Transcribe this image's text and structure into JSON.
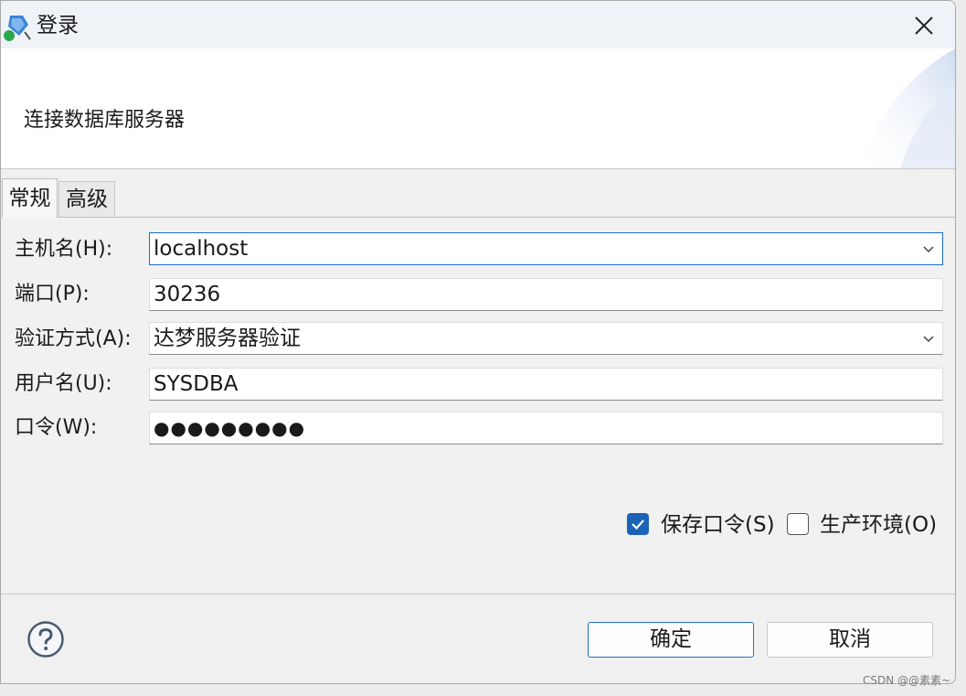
{
  "window": {
    "title": "登录",
    "app_icon": "database-connect-icon",
    "close_icon": "close-icon"
  },
  "header": {
    "description": "连接数据库服务器"
  },
  "tabs": [
    {
      "label": "常规",
      "selected": true
    },
    {
      "label": "高级",
      "selected": false
    }
  ],
  "form": {
    "host": {
      "label": "主机名(H):",
      "value": "localhost"
    },
    "port": {
      "label": "端口(P):",
      "value": "30236"
    },
    "auth": {
      "label": "验证方式(A):",
      "value": "达梦服务器验证"
    },
    "user": {
      "label": "用户名(U):",
      "value": "SYSDBA"
    },
    "password": {
      "label": "口令(W):",
      "value": "●●●●●●●●●"
    }
  },
  "options": {
    "save_password": {
      "label": "保存口令(S)",
      "checked": true
    },
    "production": {
      "label": "生产环境(O)",
      "checked": false
    }
  },
  "footer": {
    "help_icon": "help-icon",
    "ok_label": "确定",
    "cancel_label": "取消"
  },
  "watermark": "CSDN @@素素~",
  "colors": {
    "accent": "#1a63b8",
    "focus_border": "#1e6fc8",
    "header_bg": "#ffffff",
    "panel_bg": "#f1f1f1"
  }
}
